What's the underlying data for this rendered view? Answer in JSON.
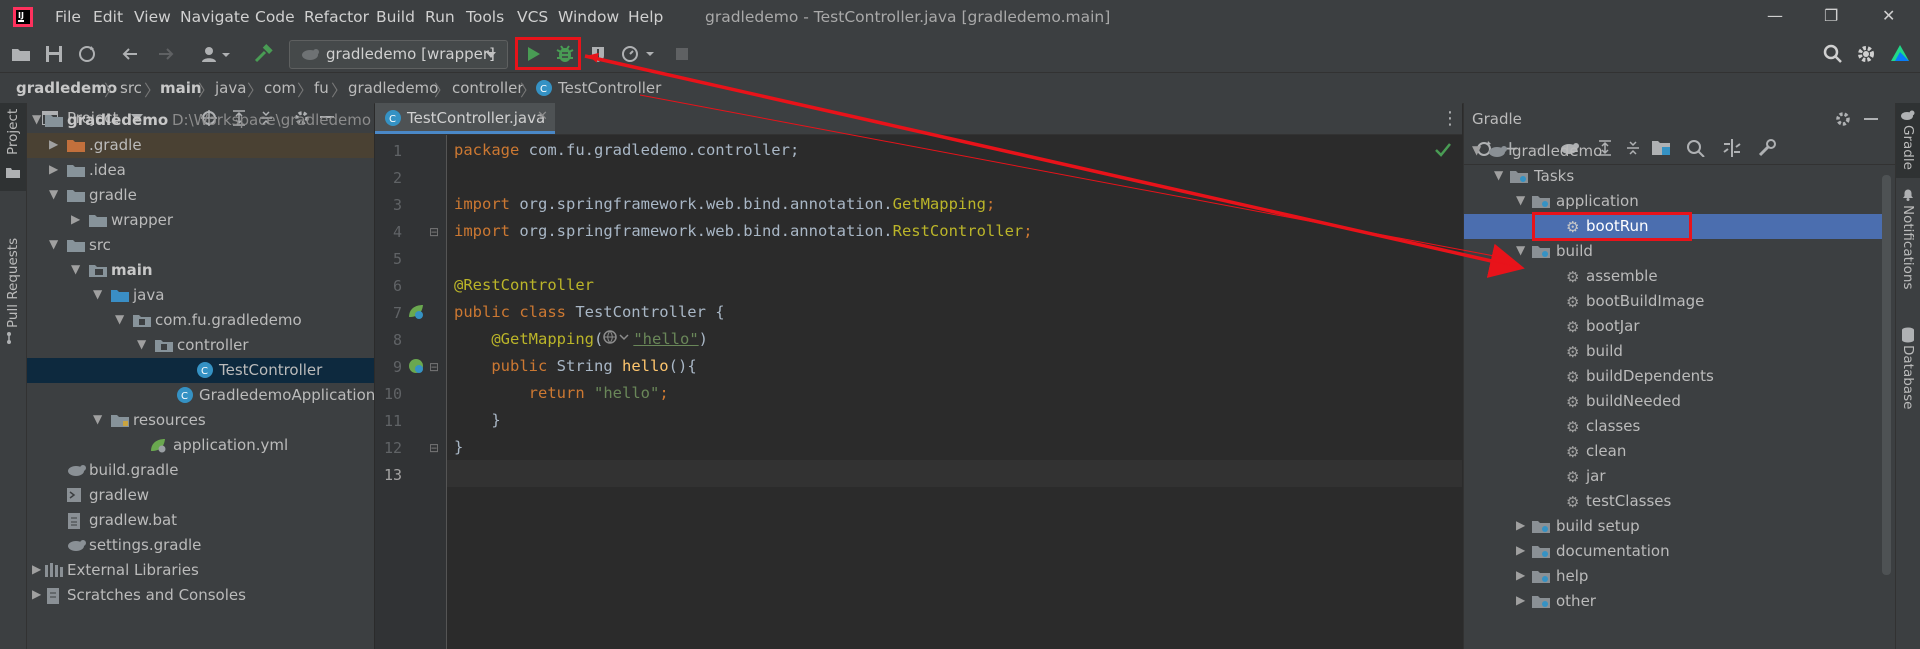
{
  "window": {
    "title": "gradledemo - TestController.java [gradledemo.main]"
  },
  "menu": [
    "File",
    "Edit",
    "View",
    "Navigate",
    "Code",
    "Refactor",
    "Build",
    "Run",
    "Tools",
    "VCS",
    "Window",
    "Help"
  ],
  "toolbar": {
    "run_config": "gradledemo [wrapper]"
  },
  "breadcrumbs": [
    "gradledemo",
    "src",
    "main",
    "java",
    "com",
    "fu",
    "gradledemo",
    "controller",
    "TestController"
  ],
  "left_strip": {
    "project": "Project",
    "pull_requests": "Pull Requests"
  },
  "project_panel": {
    "title": "Project",
    "tree": [
      {
        "label": "gradledemo",
        "extra": "D:\\Workspace\\gradledemo"
      },
      {
        "label": ".gradle"
      },
      {
        "label": ".idea"
      },
      {
        "label": "gradle"
      },
      {
        "label": "wrapper"
      },
      {
        "label": "src"
      },
      {
        "label": "main"
      },
      {
        "label": "java"
      },
      {
        "label": "com.fu.gradledemo"
      },
      {
        "label": "controller"
      },
      {
        "label": "TestController"
      },
      {
        "label": "GradledemoApplication"
      },
      {
        "label": "resources"
      },
      {
        "label": "application.yml"
      },
      {
        "label": "build.gradle"
      },
      {
        "label": "gradlew"
      },
      {
        "label": "gradlew.bat"
      },
      {
        "label": "settings.gradle"
      },
      {
        "label": "External Libraries"
      },
      {
        "label": "Scratches and Consoles"
      }
    ]
  },
  "editor": {
    "tab": "TestController.java",
    "line_numbers": [
      "1",
      "2",
      "3",
      "4",
      "5",
      "6",
      "7",
      "8",
      "9",
      "10",
      "11",
      "12",
      "13"
    ],
    "code": {
      "l1a": "package",
      "l1b": " com.fu.gradledemo.controller;",
      "l3a": "import",
      "l3b": " org.springframework.web.bind.annotation.",
      "l3c": "GetMapping",
      "l3d": ";",
      "l4a": "import",
      "l4b": " org.springframework.web.bind.annotation.",
      "l4c": "RestController",
      "l4d": ";",
      "l6": "@RestController",
      "l7a": "public class",
      "l7b": " TestController {",
      "l8a": "    @GetMapping",
      "l8b": "(",
      "l8c": "\"hello\"",
      "l8d": ")",
      "l9a": "    public",
      "l9b": " String ",
      "l9c": "hello",
      "l9d": "(){",
      "l10a": "        return",
      "l10b": " \"hello\"",
      "l10c": ";",
      "l11": "    }",
      "l12": "}"
    }
  },
  "gradle_panel": {
    "title": "Gradle",
    "tree": [
      {
        "label": "gradledemo"
      },
      {
        "label": "Tasks"
      },
      {
        "label": "application"
      },
      {
        "label": "bootRun"
      },
      {
        "label": "build"
      },
      {
        "label": "assemble"
      },
      {
        "label": "bootBuildImage"
      },
      {
        "label": "bootJar"
      },
      {
        "label": "build"
      },
      {
        "label": "buildDependents"
      },
      {
        "label": "buildNeeded"
      },
      {
        "label": "classes"
      },
      {
        "label": "clean"
      },
      {
        "label": "jar"
      },
      {
        "label": "testClasses"
      },
      {
        "label": "build setup"
      },
      {
        "label": "documentation"
      },
      {
        "label": "help"
      },
      {
        "label": "other"
      }
    ]
  },
  "right_strip": {
    "gradle": "Gradle",
    "notifications": "Notifications",
    "database": "Database"
  },
  "colors": {
    "accent_red": "#e8131a",
    "selection": "#4b6eaf",
    "run_green": "#499c54"
  }
}
